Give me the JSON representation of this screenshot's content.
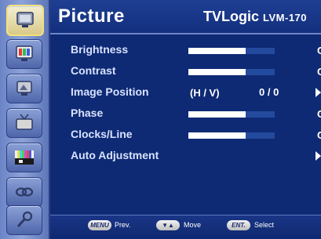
{
  "header": {
    "title": "Picture",
    "brand": "TVLogic",
    "model": "LVM-170"
  },
  "sidebar": {
    "items": [
      {
        "icon": "picture-icon",
        "active": true
      },
      {
        "icon": "color-icon",
        "active": false
      },
      {
        "icon": "image-settings-icon",
        "active": false
      },
      {
        "icon": "display-icon",
        "active": false
      },
      {
        "icon": "color-bars-icon",
        "active": false
      },
      {
        "icon": "link-icon",
        "active": false
      },
      {
        "icon": "tools-icon",
        "active": false
      }
    ]
  },
  "menu": {
    "brightness": {
      "label": "Brightness",
      "level": 0.66,
      "edge_value": "C"
    },
    "contrast": {
      "label": "Contrast",
      "level": 0.66,
      "edge_value": "C"
    },
    "image_position": {
      "label": "Image Position",
      "mode": "(H / V)",
      "value": "0 / 0"
    },
    "phase": {
      "label": "Phase",
      "level": 0.66,
      "edge_value": "C"
    },
    "clocks_line": {
      "label": "Clocks/Line",
      "level": 0.66,
      "edge_value": "C"
    },
    "auto_adjustment": {
      "label": "Auto Adjustment"
    }
  },
  "footer": {
    "prev_key": "MENU",
    "prev_label": "Prev.",
    "move_key": "▼▲",
    "move_label": "Move",
    "select_key": "ENT.",
    "select_label": "Select"
  },
  "colors": {
    "background": "#0e2a74",
    "sidebar": "#7f96d0",
    "active_highlight": "#f2e27a",
    "label": "#d8e2ff",
    "bar": "#ffffff"
  }
}
